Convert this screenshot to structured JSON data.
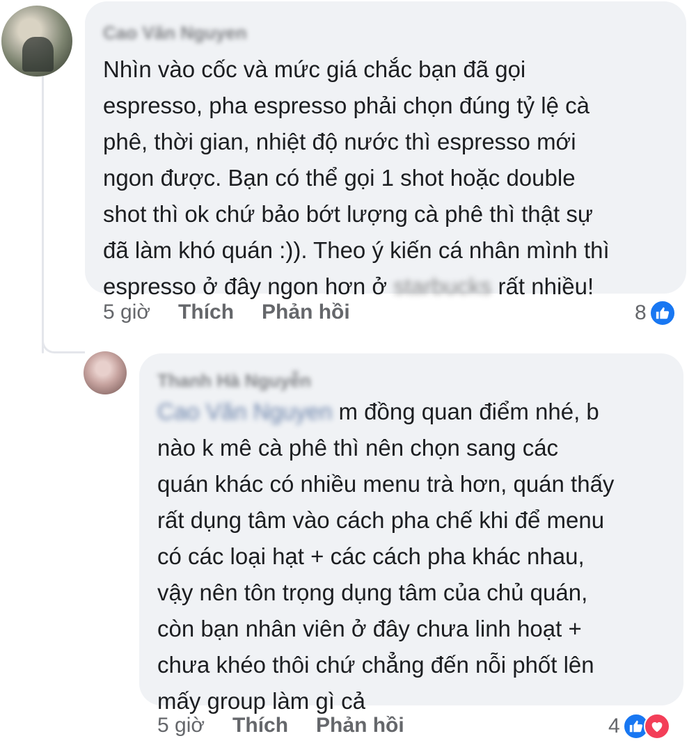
{
  "comments": [
    {
      "author": "Cao Văn Nguyen",
      "lines": [
        "Nhìn vào cốc và mức giá chắc bạn đã gọi",
        "espresso, pha espresso phải chọn đúng tỷ lệ cà",
        "phê, thời gian, nhiệt độ nước thì espresso mới",
        "ngon được. Bạn có thể gọi 1 shot hoặc double",
        "shot thì ok chứ bảo bớt lượng cà phê thì thật sự",
        "đã làm khó quán :)). Theo ý kiến cá nhân mình thì"
      ],
      "last_line_before": "espresso ở đây ngon hơn ở ",
      "blurred_word": "starbucks",
      "last_line_after": " rất nhiều!",
      "time": "5 giờ",
      "like_label": "Thích",
      "reply_label": "Phản hồi",
      "reaction_count": "8",
      "reactions": [
        "like-icon"
      ]
    },
    {
      "author": "Thanh Hà Nguyễn",
      "mention": "Cao Văn Nguyen",
      "first_line_after_mention": " m đồng quan điểm nhé, b",
      "lines": [
        "nào k mê cà phê thì nên chọn sang các",
        "quán khác có nhiều menu trà hơn, quán thấy",
        "rất dụng tâm vào cách pha chế khi để menu",
        "có các loại hạt + các cách pha khác nhau,",
        "vậy nên tôn trọng dụng tâm của chủ quán,",
        "còn bạn nhân viên ở đây chưa linh hoạt +",
        "chưa khéo thôi chứ chẳng đến nỗi phốt lên",
        "mấy group làm gì cả"
      ],
      "time": "5 giờ",
      "like_label": "Thích",
      "reply_label": "Phản hồi",
      "reaction_count": "4",
      "reactions": [
        "like-icon",
        "love-icon"
      ]
    }
  ],
  "colors": {
    "bubble": "#f0f2f5",
    "meta_text": "#65676b",
    "like_blue": "#1877f2",
    "love_red": "#f33e58"
  }
}
